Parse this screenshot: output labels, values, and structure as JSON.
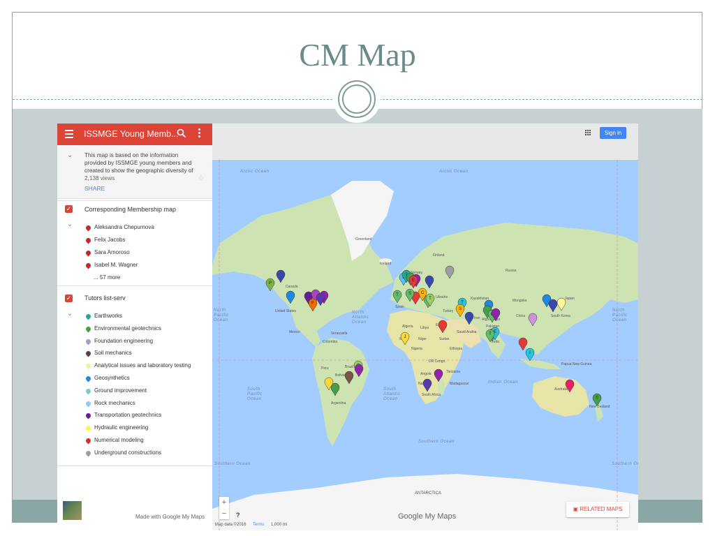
{
  "slide": {
    "title": "CM Map"
  },
  "maps_panel": {
    "title": "ISSMGE Young Memb...",
    "description": "This map is based on the information provided by ISSMGE young members and created to show the geographic diversity of",
    "views": "2,138 views",
    "share": "SHARE",
    "layers": [
      {
        "title": "Corresponding Membership map",
        "items": [
          {
            "label": "Aleksandra Chepurnova",
            "color": "#c62828"
          },
          {
            "label": "Felix Jacobs",
            "color": "#c62828"
          },
          {
            "label": "Sara Amoroso",
            "color": "#c62828"
          },
          {
            "label": "Isabel M. Wagner",
            "color": "#c62828"
          }
        ],
        "more": "... 57 more"
      },
      {
        "title": "Tutors list-serv",
        "items": [
          {
            "label": "Earthworks",
            "color": "#26a69a"
          },
          {
            "label": "Environmental geotechnics",
            "color": "#43a047"
          },
          {
            "label": "Foundation engineering",
            "color": "#9e9ecf"
          },
          {
            "label": "Soil mechanics",
            "color": "#5d4037"
          },
          {
            "label": "Analytical issues and laboratory testing",
            "color": "#f0f4a0"
          },
          {
            "label": "Geosynthetics",
            "color": "#1e88e5"
          },
          {
            "label": "Ground improvement",
            "color": "#80cbc4"
          },
          {
            "label": "Rock mechanics",
            "color": "#90caf9"
          },
          {
            "label": "Transportation geotechnics",
            "color": "#6a1b9a"
          },
          {
            "label": "Hydraulic engineering",
            "color": "#f9f94c"
          },
          {
            "label": "Numerical modeling",
            "color": "#d32f2f"
          },
          {
            "label": "Underground constructions",
            "color": "#9e9e9e"
          }
        ]
      }
    ],
    "footer": "Made with Google My Maps"
  },
  "map_toolbar": {
    "signin": "Sign in"
  },
  "map": {
    "labels": {
      "arctic_left": "Arctic Ocean",
      "arctic_right": "Arctic Ocean",
      "greenland": "Greenland",
      "iceland": "Iceland",
      "finland": "Finland",
      "russia": "Russia",
      "canada": "Canada",
      "kazakhstan": "Kazakhstan",
      "mongolia": "Mongolia",
      "china": "China",
      "united_states": "United States",
      "mexico": "Mexico",
      "north_pacific_left": "North Pacific Ocean",
      "north_atlantic": "North Atlantic Ocean",
      "north_pacific_right": "North Pacific Ocean",
      "algeria": "Algeria",
      "libya": "Libya",
      "egypt": "Egypt",
      "mali": "Mali",
      "niger": "Niger",
      "nigeria": "Nigeria",
      "sudan": "Sudan",
      "ethiopia": "Ethiopia",
      "dr_congo": "DR Congo",
      "tanzania": "Tanzania",
      "angola": "Angola",
      "namibia": "Namibia",
      "madagascar": "Madagascar",
      "south_africa": "South Africa",
      "saudi_arabia": "Saudi Arabia",
      "iran": "Iran",
      "pakistan": "Pakistan",
      "india": "India",
      "afghanistan": "Afghanistan",
      "turkey": "Turkey",
      "ukraine": "Ukraine",
      "japan": "Japan",
      "south_korea": "South Korea",
      "venezuela": "Venezuela",
      "colombia": "Colombia",
      "peru": "Peru",
      "brazil": "Brazil",
      "bolivia": "Bolivia",
      "argentina": "Argentina",
      "south_pacific": "South Pacific Ocean",
      "south_atlantic": "South Atlantic Ocean",
      "indian_ocean": "Indian Ocean",
      "australia": "Australia",
      "new_zealand": "New Zealand",
      "papua": "Papua New Guinea",
      "southern_left": "Southern Ocean",
      "southern_mid": "Southern Ocean",
      "southern_right": "Southern Ocean",
      "antarctica": "ANTARCTICA",
      "norway": "Norway",
      "spain": "Spain"
    },
    "pins": [
      {
        "color": "#7cb342",
        "letter": "P"
      },
      {
        "color": "#3949ab",
        "letter": ""
      },
      {
        "color": "#1e88e5",
        "letter": ""
      },
      {
        "color": "#6a1b9a",
        "letter": ""
      },
      {
        "color": "#ab47bc",
        "letter": ""
      },
      {
        "color": "#ef6c00",
        "letter": "F"
      },
      {
        "color": "#8e24aa",
        "letter": ""
      },
      {
        "color": "#5e35b1",
        "letter": ""
      },
      {
        "color": "#4fc3f7",
        "letter": "L"
      },
      {
        "color": "#26a69a",
        "letter": "I"
      },
      {
        "color": "#43a047",
        "letter": ""
      },
      {
        "color": "#8e24aa",
        "letter": ""
      },
      {
        "color": "#e53935",
        "letter": "E"
      },
      {
        "color": "#3949ab",
        "letter": ""
      },
      {
        "color": "#66bb6a",
        "letter": "T"
      },
      {
        "color": "#9e9e9e",
        "letter": ""
      },
      {
        "color": "#fdd835",
        "letter": "J"
      },
      {
        "color": "#66bb6a",
        "letter": "G"
      },
      {
        "color": "#ffb300",
        "letter": "C"
      },
      {
        "color": "#e53935",
        "letter": ""
      },
      {
        "color": "#66bb6a",
        "letter": "S"
      },
      {
        "color": "#9ccc65",
        "letter": "T"
      },
      {
        "color": "#26c6da",
        "letter": "T"
      },
      {
        "color": "#3949ab",
        "letter": ""
      },
      {
        "color": "#1e88e5",
        "letter": ""
      },
      {
        "color": "#43a047",
        "letter": ""
      },
      {
        "color": "#66bb6a",
        "letter": "G"
      },
      {
        "color": "#8e24aa",
        "letter": ""
      },
      {
        "color": "#e53935",
        "letter": ""
      },
      {
        "color": "#26c6da",
        "letter": "I"
      },
      {
        "color": "#1e88e5",
        "letter": ""
      },
      {
        "color": "#3949ab",
        "letter": ""
      },
      {
        "color": "#fff59d",
        "letter": ""
      },
      {
        "color": "#ce93d8",
        "letter": ""
      },
      {
        "color": "#26a69a",
        "letter": "T"
      },
      {
        "color": "#26c6da",
        "letter": "E"
      },
      {
        "color": "#66bb6a",
        "letter": "T"
      },
      {
        "color": "#ffb300",
        "letter": "S"
      },
      {
        "color": "#e53935",
        "letter": ""
      },
      {
        "color": "#795548",
        "letter": ""
      },
      {
        "color": "#9ccc65",
        "letter": "C"
      },
      {
        "color": "#8e24aa",
        "letter": ""
      },
      {
        "color": "#fdd835",
        "letter": ""
      },
      {
        "color": "#43a047",
        "letter": ""
      },
      {
        "color": "#8e24aa",
        "letter": ""
      },
      {
        "color": "#5e35b1",
        "letter": ""
      },
      {
        "color": "#e91e63",
        "letter": ""
      },
      {
        "color": "#43a047",
        "letter": "T"
      }
    ],
    "zoom_in": "+",
    "zoom_out": "−",
    "help": "?",
    "related_maps": "RELATED MAPS",
    "google": "Google",
    "my_maps": "My Maps",
    "attribution": {
      "data": "Map data ©2016",
      "terms": "Terms",
      "scale": "1,000 mi"
    }
  }
}
